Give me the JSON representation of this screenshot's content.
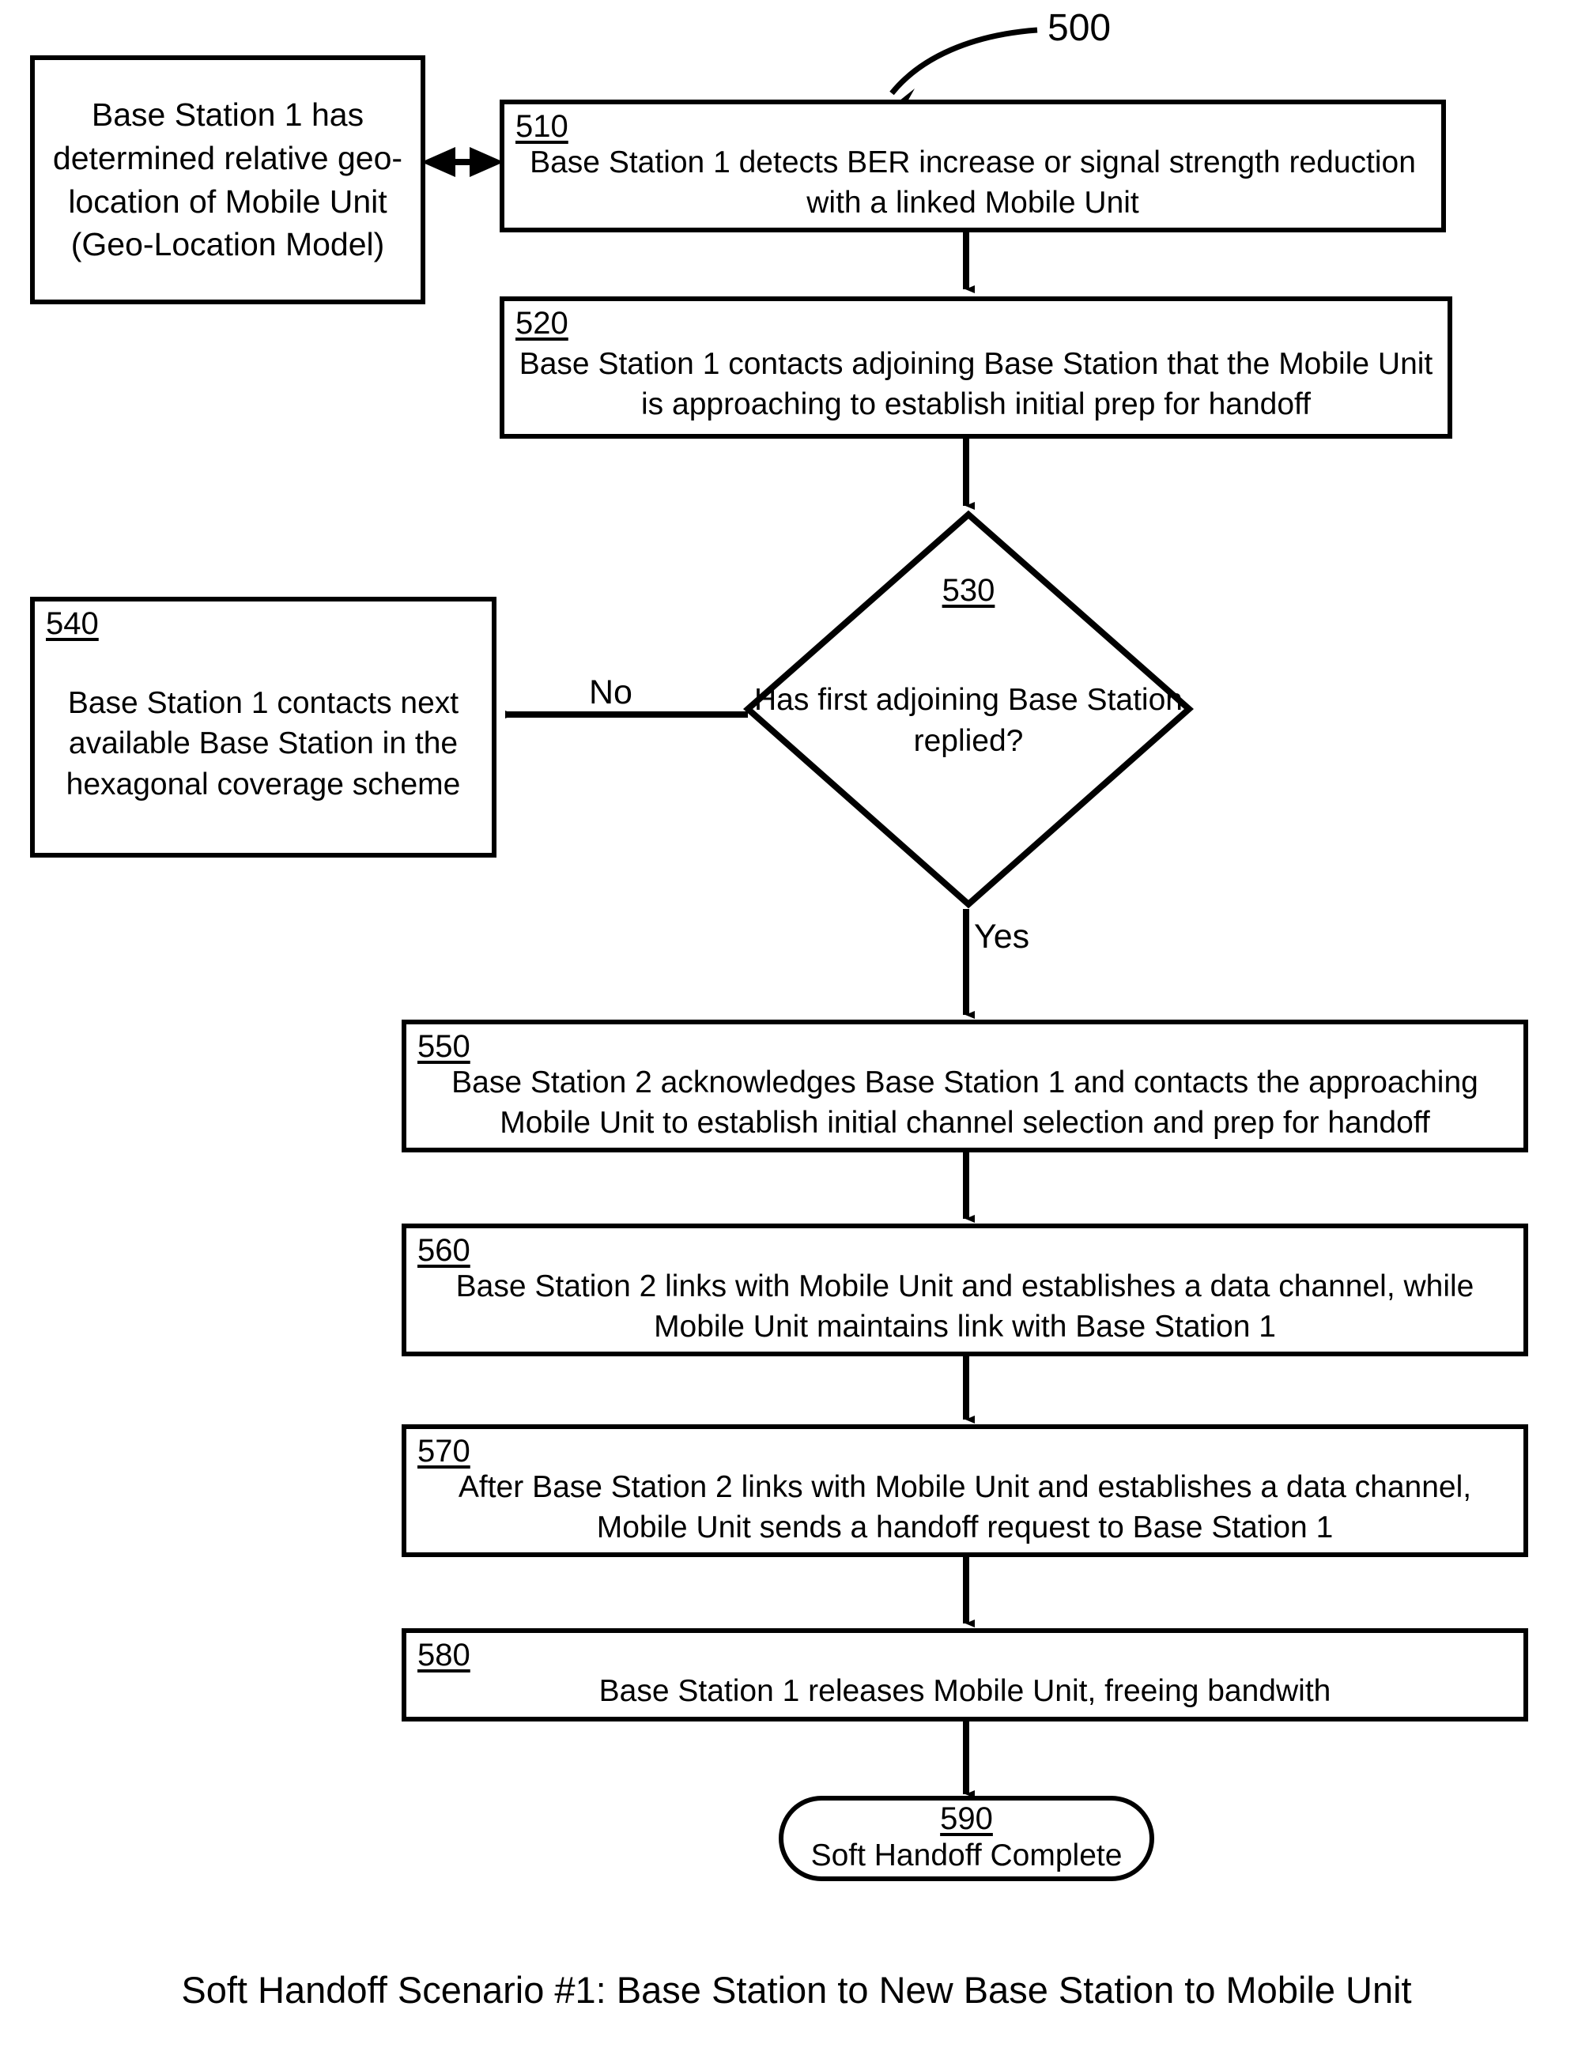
{
  "figure": {
    "reference_numeral": "500",
    "caption": "Soft Handoff Scenario #1: Base Station to New Base Station to Mobile Unit"
  },
  "nodes": {
    "geo_note": {
      "text": "Base Station 1 has determined relative geo-location of Mobile Unit (Geo-Location Model)"
    },
    "n510": {
      "ref": "510",
      "text": "Base Station 1 detects BER increase or signal strength reduction with a linked Mobile Unit"
    },
    "n520": {
      "ref": "520",
      "text": "Base Station 1 contacts adjoining Base Station that the Mobile Unit is approaching to establish initial prep for handoff"
    },
    "n530": {
      "ref": "530",
      "text": "Has first adjoining Base Station replied?",
      "shape": "diamond"
    },
    "n540": {
      "ref": "540",
      "text": "Base Station 1 contacts next available Base Station in the hexagonal coverage scheme"
    },
    "n550": {
      "ref": "550",
      "text": "Base Station 2 acknowledges Base Station 1 and contacts the approaching Mobile Unit to establish initial channel selection and prep for handoff"
    },
    "n560": {
      "ref": "560",
      "text": "Base Station 2 links with Mobile Unit and establishes a data channel, while Mobile Unit maintains link with Base Station 1"
    },
    "n570": {
      "ref": "570",
      "text": "After Base Station 2 links with Mobile Unit and establishes a data channel, Mobile Unit sends a handoff request to Base Station 1"
    },
    "n580": {
      "ref": "580",
      "text": "Base Station 1 releases Mobile Unit, freeing bandwith"
    },
    "n590": {
      "ref": "590",
      "text": "Soft Handoff Complete",
      "shape": "terminator"
    }
  },
  "edge_labels": {
    "no": "No",
    "yes": "Yes"
  },
  "colors": {
    "stroke": "#000000",
    "background": "#ffffff"
  }
}
